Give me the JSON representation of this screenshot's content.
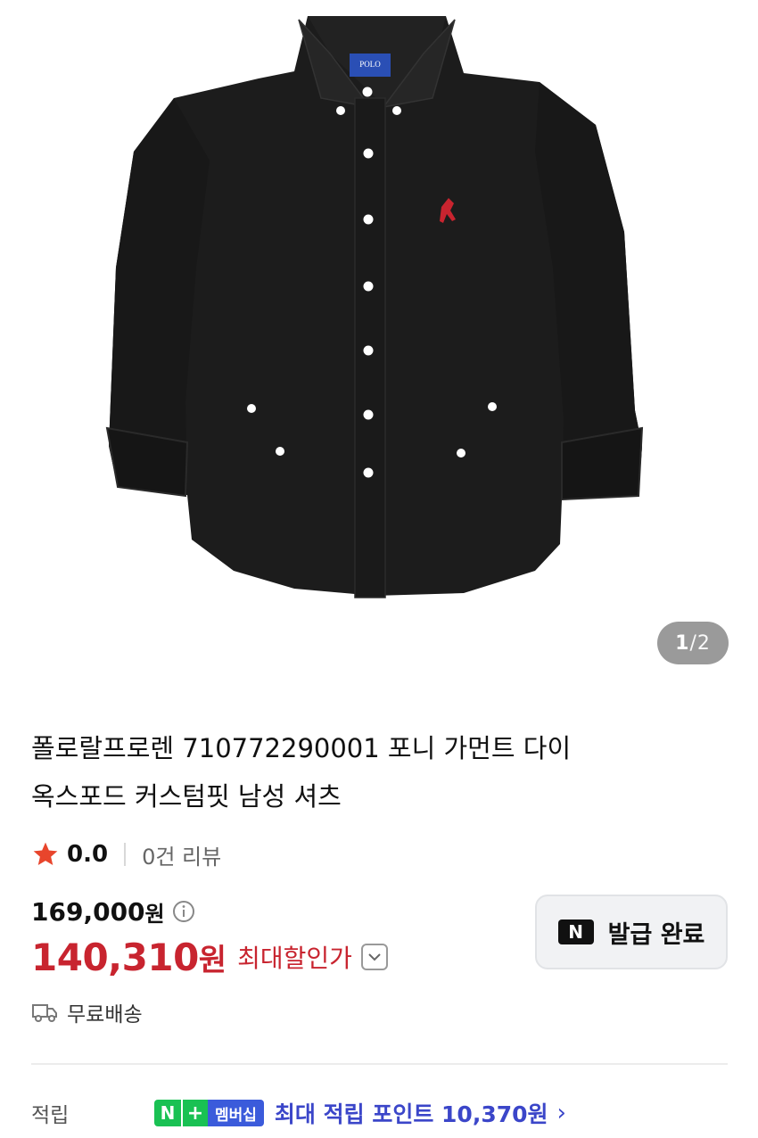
{
  "gallery": {
    "current": "1",
    "separator": "/",
    "total": "2",
    "logo_text": "POLO"
  },
  "product": {
    "title_line1": "폴로랄프로렌 710772290001 포니 가먼트 다이",
    "title_line2": "옥스포드 커스텀핏 남성 셔츠"
  },
  "rating": {
    "score": "0.0",
    "reviews": "0건 리뷰"
  },
  "price": {
    "original": "169,000",
    "original_unit": "원",
    "sale": "140,310",
    "sale_unit": "원",
    "sale_label": "최대할인가"
  },
  "coupon": {
    "badge": "N",
    "label": "발급 완료"
  },
  "shipping": {
    "label": "무료배송"
  },
  "points": {
    "label": "적립",
    "badge_n": "N",
    "badge_plus": "+",
    "badge_membership": "멤버십",
    "text": "최대 적립 포인트 10,370원",
    "arrow": "›"
  },
  "colors": {
    "sale_red": "#c8242f",
    "points_blue": "#3b46c9",
    "naver_green": "#19c153"
  }
}
